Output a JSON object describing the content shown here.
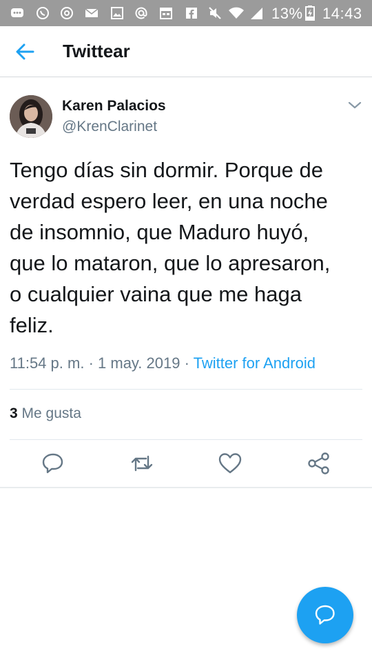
{
  "status_bar": {
    "battery_percent": "13%",
    "time": "14:43",
    "icons": [
      "chat-icon",
      "whatsapp-icon",
      "at-sign-icon",
      "mail-icon",
      "gallery-icon",
      "at-icon",
      "calendar-icon",
      "facebook-icon",
      "mute-icon",
      "wifi-icon",
      "signal-icon",
      "battery-charging-icon"
    ]
  },
  "header": {
    "title": "Twittear",
    "back_icon": "arrow-left-icon"
  },
  "tweet": {
    "author_name": "Karen Palacios",
    "author_handle": "@KrenClarinet",
    "text": "Tengo días sin dormir. Porque de\nverdad espero leer, en una noche\nde insomnio, que  Maduro huyó,\nque lo mataron, que lo apresaron,\no cualquier vaina que me haga\nfeliz.",
    "time": "11:54 p. m.",
    "separator": "·",
    "date": "1 may. 2019",
    "source": "Twitter for Android",
    "likes_count": "3",
    "likes_label": "Me gusta"
  },
  "actions": [
    "reply-icon",
    "retweet-icon",
    "like-icon",
    "share-icon"
  ],
  "fab": {
    "icon": "compose-reply-icon"
  },
  "colors": {
    "status_bar": "#9b9b9b",
    "accent": "#1da1f2",
    "text_primary": "#14171a",
    "text_secondary": "#657786"
  }
}
